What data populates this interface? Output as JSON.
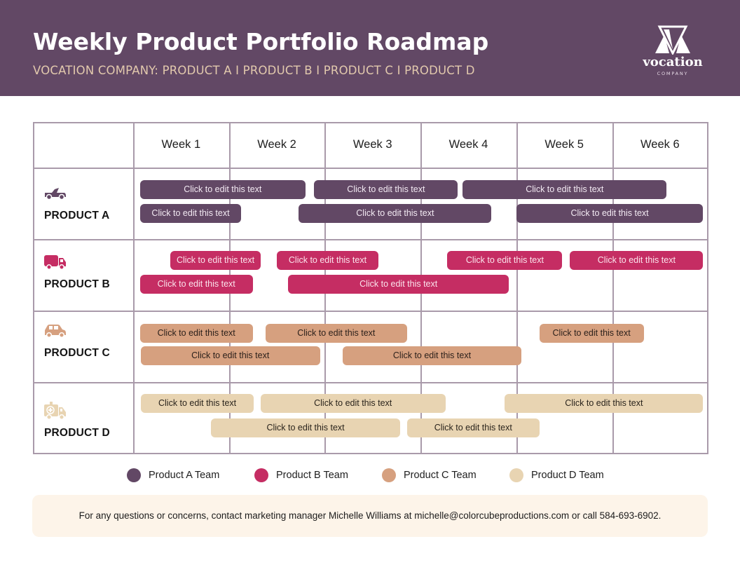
{
  "header": {
    "title": "Weekly Product Portfolio Roadmap",
    "subtitle": "VOCATION COMPANY: PRODUCT A I PRODUCT B I PRODUCT C I PRODUCT D",
    "logo": {
      "icon": "vocation-v-logo-icon",
      "wordmark": "vocation",
      "tagline": "COMPANY"
    }
  },
  "colors": {
    "header_bg": "#624865",
    "subtitle": "#e2c9ad",
    "grid_line": "#a99aaa",
    "product_a": "#624865",
    "product_b": "#c52d63",
    "product_c": "#d6a07f",
    "product_d": "#e8d4b2",
    "footer_bg": "#fdf4e9"
  },
  "weeks": [
    "Week 1",
    "Week 2",
    "Week 3",
    "Week 4",
    "Week 5",
    "Week 6"
  ],
  "products": [
    {
      "label": "PRODUCT A",
      "icon": "convertible-car-icon",
      "color": "#624865",
      "text_color": "#f3eaf3",
      "bars": [
        {
          "lane": 0,
          "start_week": 0.07,
          "end_week": 1.8,
          "text": "Click to edit this text"
        },
        {
          "lane": 0,
          "start_week": 1.89,
          "end_week": 3.39,
          "text": "Click to edit this text"
        },
        {
          "lane": 0,
          "start_week": 3.44,
          "end_week": 5.57,
          "text": "Click to edit this text"
        },
        {
          "lane": 1,
          "start_week": 0.07,
          "end_week": 1.13,
          "text": "Click to edit this text"
        },
        {
          "lane": 1,
          "start_week": 1.73,
          "end_week": 3.74,
          "text": "Click to edit this text"
        },
        {
          "lane": 1,
          "start_week": 4.0,
          "end_week": 5.95,
          "text": "Click to edit this text"
        }
      ]
    },
    {
      "label": "PRODUCT B",
      "icon": "delivery-truck-icon",
      "color": "#c52d63",
      "text_color": "#fbe3ec",
      "bars": [
        {
          "lane": 0,
          "start_week": 0.39,
          "end_week": 1.33,
          "text": "Click to edit this text"
        },
        {
          "lane": 0,
          "start_week": 1.5,
          "end_week": 2.56,
          "text": "Click to edit this text"
        },
        {
          "lane": 0,
          "start_week": 3.28,
          "end_week": 4.48,
          "text": "Click to edit this text"
        },
        {
          "lane": 0,
          "start_week": 4.56,
          "end_week": 5.95,
          "text": "Click to edit this text"
        },
        {
          "lane": 1,
          "start_week": 0.07,
          "end_week": 1.25,
          "text": "Click to edit this text"
        },
        {
          "lane": 1,
          "start_week": 1.62,
          "end_week": 3.92,
          "text": "Click to edit this text"
        }
      ]
    },
    {
      "label": "PRODUCT C",
      "icon": "car-icon",
      "color": "#d6a07f",
      "text_color": "#2a1f1a",
      "bars": [
        {
          "lane": 0,
          "start_week": 0.07,
          "end_week": 1.25,
          "text": "Click to edit this text"
        },
        {
          "lane": 0,
          "start_week": 1.38,
          "end_week": 2.86,
          "text": "Click to edit this text"
        },
        {
          "lane": 0,
          "start_week": 4.24,
          "end_week": 5.33,
          "text": "Click to edit this text"
        },
        {
          "lane": 1,
          "start_week": 0.08,
          "end_week": 1.95,
          "text": "Click to edit this text"
        },
        {
          "lane": 1,
          "start_week": 2.19,
          "end_week": 4.05,
          "text": "Click to edit this text"
        }
      ]
    },
    {
      "label": "PRODUCT D",
      "icon": "ambulance-icon",
      "color": "#e8d4b2",
      "text_color": "#2a241c",
      "bars": [
        {
          "lane": 0,
          "start_week": 0.08,
          "end_week": 1.26,
          "text": "Click to edit this text"
        },
        {
          "lane": 0,
          "start_week": 1.33,
          "end_week": 3.26,
          "text": "Click to edit this text"
        },
        {
          "lane": 0,
          "start_week": 3.88,
          "end_week": 5.95,
          "text": "Click to edit this text"
        },
        {
          "lane": 1,
          "start_week": 0.81,
          "end_week": 2.79,
          "text": "Click to edit this text"
        },
        {
          "lane": 1,
          "start_week": 2.86,
          "end_week": 4.24,
          "text": "Click to edit this text"
        }
      ]
    }
  ],
  "legend": [
    {
      "label": "Product A Team",
      "color": "#624865"
    },
    {
      "label": "Product B Team",
      "color": "#c52d63"
    },
    {
      "label": "Product C Team",
      "color": "#d6a07f"
    },
    {
      "label": "Product D Team",
      "color": "#e8d4b2"
    }
  ],
  "footer": {
    "text": "For any questions or concerns, contact marketing manager Michelle Williams at michelle@colorcubeproductions.com or call 584-693-6902."
  }
}
